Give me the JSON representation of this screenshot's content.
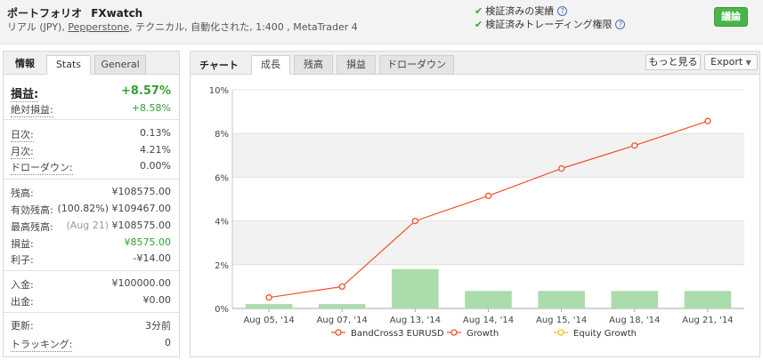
{
  "header": {
    "title": "ポートフォリオ",
    "account": "FXwatch",
    "sub_type": "リアル (JPY),",
    "broker": "Pepperstone",
    "sub_rest": ", テクニカル, 自動化された, 1:400 , MetaTrader 4",
    "verified_track": "検証済みの実績",
    "verified_trading": "検証済みトレーディング権限",
    "discuss_label": "議論"
  },
  "left_panel": {
    "tabs": {
      "info": "情報",
      "stats": "Stats",
      "general": "General"
    },
    "gain": {
      "label": "損益:",
      "value": "+8.57%"
    },
    "abs_gain": {
      "label": "絶対損益:",
      "value": "+8.58%"
    },
    "daily": {
      "label": "日次:",
      "value": "0.13%"
    },
    "monthly": {
      "label": "月次:",
      "value": "4.21%"
    },
    "drawdown": {
      "label": "ドローダウン:",
      "value": "0.00%"
    },
    "balance": {
      "label": "残高:",
      "value": "¥108575.00"
    },
    "equity": {
      "label": "有効残高:",
      "pct": "(100.82%)",
      "value": "¥109467.00"
    },
    "highest": {
      "label": "最高残高:",
      "date": "(Aug 21)",
      "value": "¥108575.00"
    },
    "profit": {
      "label": "損益:",
      "value": "¥8575.00"
    },
    "interest": {
      "label": "利子:",
      "value": "-¥14.00"
    },
    "deposits": {
      "label": "入金:",
      "value": "¥100000.00"
    },
    "withdrawals": {
      "label": "出金:",
      "value": "¥0.00"
    },
    "updated": {
      "label": "更新:",
      "value": "3分前"
    },
    "tracking": {
      "label": "トラッキング:",
      "value": "0"
    }
  },
  "chart_panel": {
    "label": "チャート",
    "tabs": [
      "成長",
      "残高",
      "損益",
      "ドローダウン"
    ],
    "more_button": "もっと見る",
    "export_button": "Export"
  },
  "chart_data": {
    "type": "line",
    "categories": [
      "Aug 05, '14",
      "Aug 07, '14",
      "Aug 13, '14",
      "Aug 14, '14",
      "Aug 15, '14",
      "Aug 18, '14",
      "Aug 21, '14"
    ],
    "y_ticks": [
      "0%",
      "2%",
      "4%",
      "6%",
      "8%",
      "10%"
    ],
    "ylim": [
      0,
      10
    ],
    "series": [
      {
        "name": "BandCross3 EURUSD",
        "type": "bar",
        "color": "#abdcab",
        "values": [
          0.2,
          0.2,
          1.8,
          0.8,
          0.8,
          0.8,
          0.8
        ]
      },
      {
        "name": "Growth",
        "type": "line",
        "color": "#f0512a",
        "values": [
          0.5,
          1.0,
          4.0,
          5.15,
          6.4,
          7.45,
          8.57
        ]
      },
      {
        "name": "Equity Growth",
        "type": "line",
        "color": "#f2c21b",
        "values": []
      }
    ],
    "legend_position": "bottom"
  }
}
